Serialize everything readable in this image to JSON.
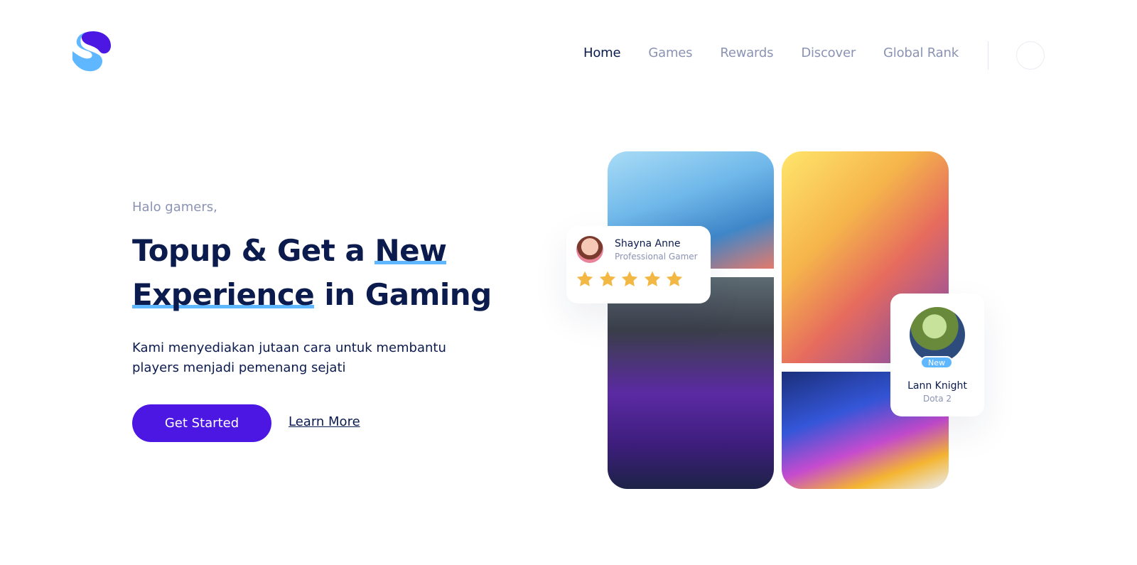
{
  "nav": {
    "items": [
      {
        "label": "Home",
        "active": true
      },
      {
        "label": "Games",
        "active": false
      },
      {
        "label": "Rewards",
        "active": false
      },
      {
        "label": "Discover",
        "active": false
      },
      {
        "label": "Global Rank",
        "active": false
      }
    ]
  },
  "hero": {
    "greeting": "Halo gamers,",
    "headline_1": "Topup & Get a",
    "headline_hl_1": "New",
    "headline_hl_2": "Experience",
    "headline_2": "in Gaming",
    "description": "Kami menyediakan jutaan cara untuk membantu players menjadi pemenang sejati",
    "primary_button": "Get Started",
    "secondary_link": "Learn More"
  },
  "cards": {
    "reviewer": {
      "name": "Shayna Anne",
      "role": "Professional Gamer",
      "rating": 5,
      "rating_max": 5
    },
    "player": {
      "name": "Lann Knight",
      "game": "Dota 2",
      "badge": "New"
    }
  },
  "colors": {
    "primary": "#4c17e3",
    "accent": "#5fb8ff",
    "heading": "#0b1b4d",
    "muted": "#8b93b3",
    "star": "#f3b844"
  },
  "icons": {
    "logo": "brand-s-logo",
    "star": "star-icon"
  }
}
